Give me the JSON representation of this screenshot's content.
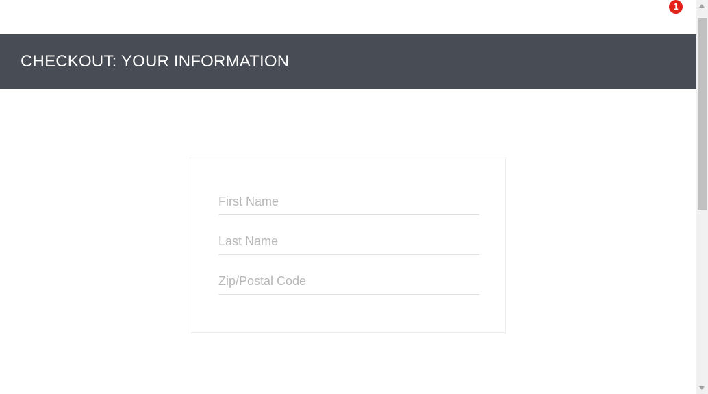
{
  "cart": {
    "badge_count": "1",
    "badge_color": "#e2231a"
  },
  "header": {
    "title": "CHECKOUT: YOUR INFORMATION",
    "background_color": "#484c55"
  },
  "form": {
    "first_name": {
      "value": "",
      "placeholder": "First Name"
    },
    "last_name": {
      "value": "",
      "placeholder": "Last Name"
    },
    "postal_code": {
      "value": "",
      "placeholder": "Zip/Postal Code"
    }
  },
  "scrollbar": {
    "icons": [
      "scroll-up-arrow-icon",
      "scroll-down-arrow-icon"
    ]
  }
}
